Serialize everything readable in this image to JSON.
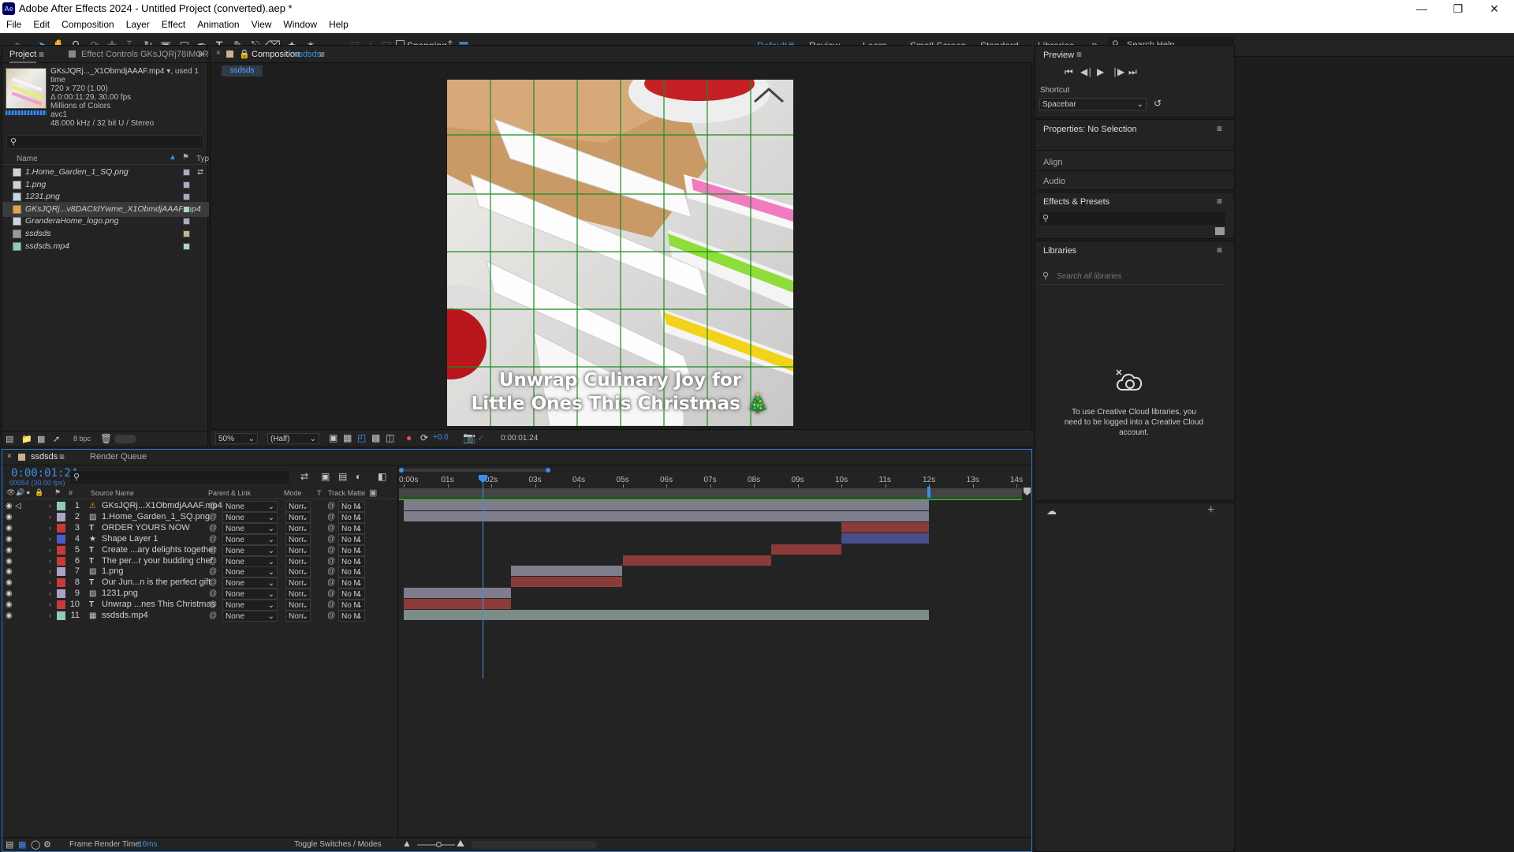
{
  "app": {
    "title": "Adobe After Effects 2024 - Untitled Project (converted).aep *",
    "icon_text": "Ae"
  },
  "menu": [
    "File",
    "Edit",
    "Composition",
    "Layer",
    "Effect",
    "Animation",
    "View",
    "Window",
    "Help"
  ],
  "toolbar": {
    "snapping": "Snapping",
    "workspaces": [
      "Default",
      "Review",
      "Learn",
      "Small Screen",
      "Standard",
      "Libraries"
    ],
    "search_placeholder": "Search Help"
  },
  "project_panel": {
    "tab": "Project",
    "effect_controls_tab": "Effect Controls GKsJQRj78IMGR",
    "footage": {
      "name": "GKsJQRj..._X1ObmdjAAAF.mp4",
      "used": ", used 1 time",
      "dims": "720 x 720 (1.00)",
      "duration": "Δ 0:00:11:29, 30.00 fps",
      "colors": "Millions of Colors",
      "codec": "avc1",
      "audio": "48.000 kHz / 32 bit U / Stereo"
    },
    "columns": {
      "name": "Name",
      "type": "Typ"
    },
    "items": [
      {
        "name": "1.Home_Garden_1_SQ.png",
        "color": "#b0a8c8"
      },
      {
        "name": "1.png",
        "color": "#b0a8c8"
      },
      {
        "name": "1231.png",
        "color": "#b0a8c8"
      },
      {
        "name": "GKsJQRj...v8DACIdYwme_X1ObmdjAAAF.mp4",
        "color": "#a8d8c8"
      },
      {
        "name": "GranderaHome_logo.png",
        "color": "#b0a8c8"
      },
      {
        "name": "ssdsds",
        "color": "#c8b48c"
      },
      {
        "name": "ssdsds.mp4",
        "color": "#a8d8c8"
      }
    ],
    "bpc": "8 bpc"
  },
  "composition": {
    "tab": "Composition",
    "name": "ssdsds",
    "tab_label": "ssdsds",
    "zoom": "50%",
    "resolution": "(Half)",
    "exposure": "+0.0",
    "timecode": "0:00:01:24",
    "caption_line1": "Unwrap Culinary Joy for",
    "caption_line2": "Little Ones This Christmas 🎄"
  },
  "right": {
    "preview": "Preview",
    "shortcut_label": "Shortcut",
    "shortcut_value": "Spacebar",
    "properties": "Properties: No Selection",
    "align": "Align",
    "audio": "Audio",
    "effects": "Effects & Presets",
    "libraries": "Libraries",
    "lib_search": "Search all libraries",
    "cc_message": "To use Creative Cloud libraries, you need to be logged into a Creative Cloud account."
  },
  "timeline": {
    "tab": "ssdsds",
    "render_queue": "Render Queue",
    "timecode": "0:00:01:24",
    "frames": "00054 (30.00 fps)",
    "col_source": "Source Name",
    "col_parent": "Parent & Link",
    "col_mode": "Mode",
    "col_t": "T",
    "col_matte": "Track Matte",
    "ruler": [
      "0:00s",
      "01s",
      "02s",
      "03s",
      "04s",
      "05s",
      "06s",
      "07s",
      "08s",
      "09s",
      "10s",
      "11s",
      "12s",
      "13s",
      "14s"
    ],
    "ruler_seconds": [
      0,
      1,
      2,
      3,
      4,
      5,
      6,
      7,
      8,
      9,
      10,
      11,
      12,
      13,
      14
    ],
    "playhead_seconds": 1.8,
    "comp_end_seconds": 12,
    "parent_value": "None",
    "mode_value": "Norr",
    "matte_value": "No M",
    "layers": [
      {
        "num": "1",
        "name": "GKsJQRj...X1ObmdjAAAF.mp4",
        "icon": "vid-warn",
        "color": "#8fc9b9",
        "in": 0,
        "out": 12,
        "bar": "#7d7d8c"
      },
      {
        "num": "2",
        "name": "1.Home_Garden_1_SQ.png",
        "icon": "img",
        "color": "#a9a3c5",
        "in": 0,
        "out": 12,
        "bar": "#7d7d8c"
      },
      {
        "num": "3",
        "name": "ORDER YOURS NOW",
        "icon": "T",
        "color": "#c83a3a",
        "in": 10,
        "out": 12,
        "bar": "#8c3b3b"
      },
      {
        "num": "4",
        "name": "Shape Layer 1",
        "icon": "star",
        "color": "#4a5bd0",
        "in": 10,
        "out": 12,
        "bar": "#4a4f8c"
      },
      {
        "num": "5",
        "name": "Create ...ary delights together",
        "icon": "T",
        "color": "#c83a3a",
        "in": 8.4,
        "out": 10,
        "bar": "#8c3b3b"
      },
      {
        "num": "6",
        "name": "The per...r your budding chef",
        "icon": "T",
        "color": "#c83a3a",
        "in": 5,
        "out": 8.4,
        "bar": "#8c3b3b"
      },
      {
        "num": "7",
        "name": "1.png",
        "icon": "img",
        "color": "#a9a3c5",
        "in": 2.45,
        "out": 5,
        "bar": "#7d7d8c"
      },
      {
        "num": "8",
        "name": "Our Jun...n is the perfect gift",
        "icon": "T",
        "color": "#c83a3a",
        "in": 2.45,
        "out": 5,
        "bar": "#8c3b3b"
      },
      {
        "num": "9",
        "name": "1231.png",
        "icon": "img",
        "color": "#a9a3c5",
        "in": 0,
        "out": 2.45,
        "bar": "#7d7d8c"
      },
      {
        "num": "10",
        "name": "Unwrap ...nes This Christmas",
        "icon": "T",
        "color": "#c83a3a",
        "in": 0,
        "out": 2.45,
        "bar": "#8c3b3b"
      },
      {
        "num": "11",
        "name": "ssdsds.mp4",
        "icon": "vid",
        "color": "#8fc9b9",
        "in": 0,
        "out": 12,
        "bar": "#7c8c86"
      }
    ],
    "frame_render_label": "Frame Render Time:",
    "frame_render_value": "16ms",
    "toggle": "Toggle Switches / Modes"
  }
}
